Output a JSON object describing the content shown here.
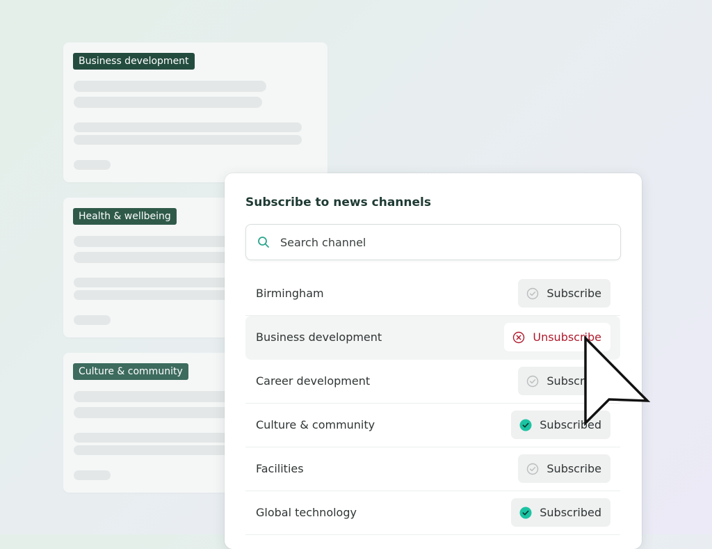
{
  "background_cards": [
    {
      "tag": "Business development",
      "tag_color": "#234c3f"
    },
    {
      "tag": "Health & wellbeing",
      "tag_color": "#2f5a4a"
    },
    {
      "tag": "Culture & community",
      "tag_color": "#3d6b5e"
    }
  ],
  "panel": {
    "title": "Subscribe to news channels",
    "search_placeholder": "Search channel"
  },
  "channels": [
    {
      "name": "Birmingham",
      "status": "subscribe",
      "button_label": "Subscribe",
      "icon": "check-circle-outline-icon"
    },
    {
      "name": "Business development",
      "status": "unsubscribe",
      "button_label": "Unsubscribe",
      "icon": "x-circle-icon"
    },
    {
      "name": "Career development",
      "status": "subscribe",
      "button_label": "Subscribe",
      "icon": "check-circle-outline-icon"
    },
    {
      "name": "Culture & community",
      "status": "subscribed",
      "button_label": "Subscribed",
      "icon": "check-circle-filled-icon"
    },
    {
      "name": "Facilities",
      "status": "subscribe",
      "button_label": "Subscribe",
      "icon": "check-circle-outline-icon"
    },
    {
      "name": "Global technology",
      "status": "subscribed",
      "button_label": "Subscribed",
      "icon": "check-circle-filled-icon"
    }
  ],
  "colors": {
    "accent_teal": "#1cc3a2",
    "unsubscribe_red": "#b0192c",
    "title_dark_green": "#1e3a33"
  }
}
